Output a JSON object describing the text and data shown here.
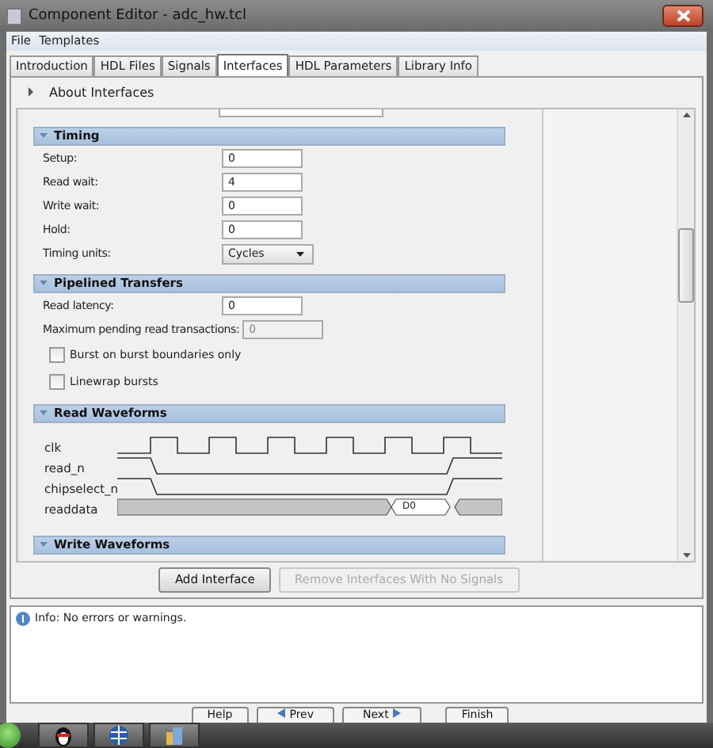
{
  "window": {
    "title": "Component Editor - adc_hw.tcl"
  },
  "menu": [
    "File",
    "Templates"
  ],
  "tabs": [
    {
      "label": "Introduction",
      "selected": false
    },
    {
      "label": "HDL Files",
      "selected": false
    },
    {
      "label": "Signals",
      "selected": false
    },
    {
      "label": "Interfaces",
      "selected": true
    },
    {
      "label": "HDL Parameters",
      "selected": false
    },
    {
      "label": "Library Info",
      "selected": false
    }
  ],
  "about": {
    "label": "About Interfaces",
    "expanded": false
  },
  "sections": [
    {
      "title": "Timing",
      "expanded": true,
      "rows": [
        {
          "kind": "field",
          "label": "Setup:",
          "value": "0",
          "disabled": false
        },
        {
          "kind": "field",
          "label": "Read wait:",
          "value": "4",
          "disabled": false
        },
        {
          "kind": "field",
          "label": "Write wait:",
          "value": "0",
          "disabled": false
        },
        {
          "kind": "field",
          "label": "Hold:",
          "value": "0",
          "disabled": false
        },
        {
          "kind": "select",
          "label": "Timing units:",
          "value": "Cycles"
        }
      ]
    },
    {
      "title": "Pipelined Transfers",
      "expanded": true,
      "rows": [
        {
          "kind": "field",
          "label": "Read latency:",
          "value": "0",
          "disabled": false
        },
        {
          "kind": "field",
          "label": "Maximum pending read transactions:",
          "value": "0",
          "disabled": true
        },
        {
          "kind": "checkbox",
          "label": "Burst on burst boundaries only",
          "checked": false
        },
        {
          "kind": "checkbox",
          "label": "Linewrap bursts",
          "checked": false
        }
      ]
    },
    {
      "title": "Read Waveforms",
      "expanded": true,
      "waveform": {
        "signals": [
          "clk",
          "read_n",
          "chipselect_n",
          "readdata"
        ],
        "data_label": "D0"
      }
    },
    {
      "title": "Write Waveforms",
      "expanded": true
    }
  ],
  "actions": [
    {
      "label": "Add Interface",
      "disabled": false
    },
    {
      "label": "Remove Interfaces With No Signals",
      "disabled": true
    }
  ],
  "messages": [
    {
      "kind": "info",
      "text": "Info: No errors or warnings."
    }
  ],
  "footer_buttons": [
    {
      "label": "Help",
      "kind": "plain"
    },
    {
      "label": "Prev",
      "kind": "prev"
    },
    {
      "label": "Next",
      "kind": "next"
    },
    {
      "label": "Finish",
      "kind": "plain"
    }
  ]
}
